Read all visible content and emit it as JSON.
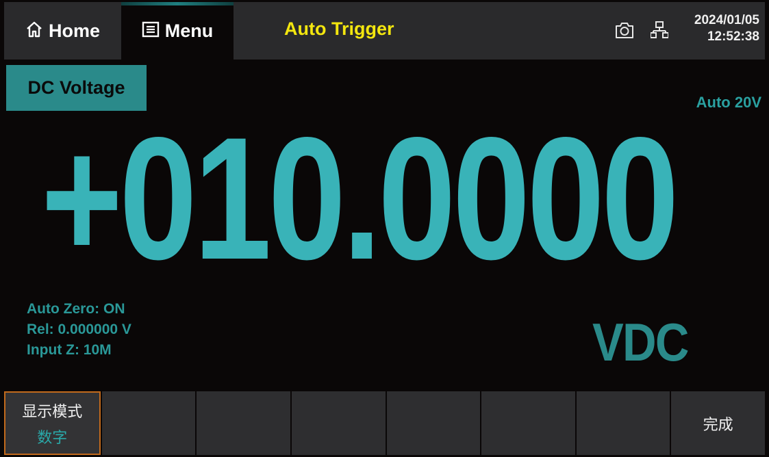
{
  "topbar": {
    "home_label": "Home",
    "menu_label": "Menu",
    "trigger_text": "Auto Trigger",
    "date": "2024/01/05",
    "time": "12:52:38"
  },
  "measurement": {
    "function": "DC Voltage",
    "range": "Auto 20V",
    "reading": "+010.0000",
    "unit": "VDC",
    "auto_zero": "Auto Zero: ON",
    "rel": "Rel: 0.000000 V",
    "input_z": "Input Z: 10M"
  },
  "softkeys": [
    {
      "label": "显示模式",
      "value": "数字"
    },
    {
      "label": "",
      "value": ""
    },
    {
      "label": "",
      "value": ""
    },
    {
      "label": "",
      "value": ""
    },
    {
      "label": "",
      "value": ""
    },
    {
      "label": "",
      "value": ""
    },
    {
      "label": "",
      "value": ""
    },
    {
      "label": "完成",
      "value": ""
    }
  ],
  "colors": {
    "accent": "#39b3b8",
    "trigger": "#f3e60f",
    "active_border": "#c26a1c"
  }
}
